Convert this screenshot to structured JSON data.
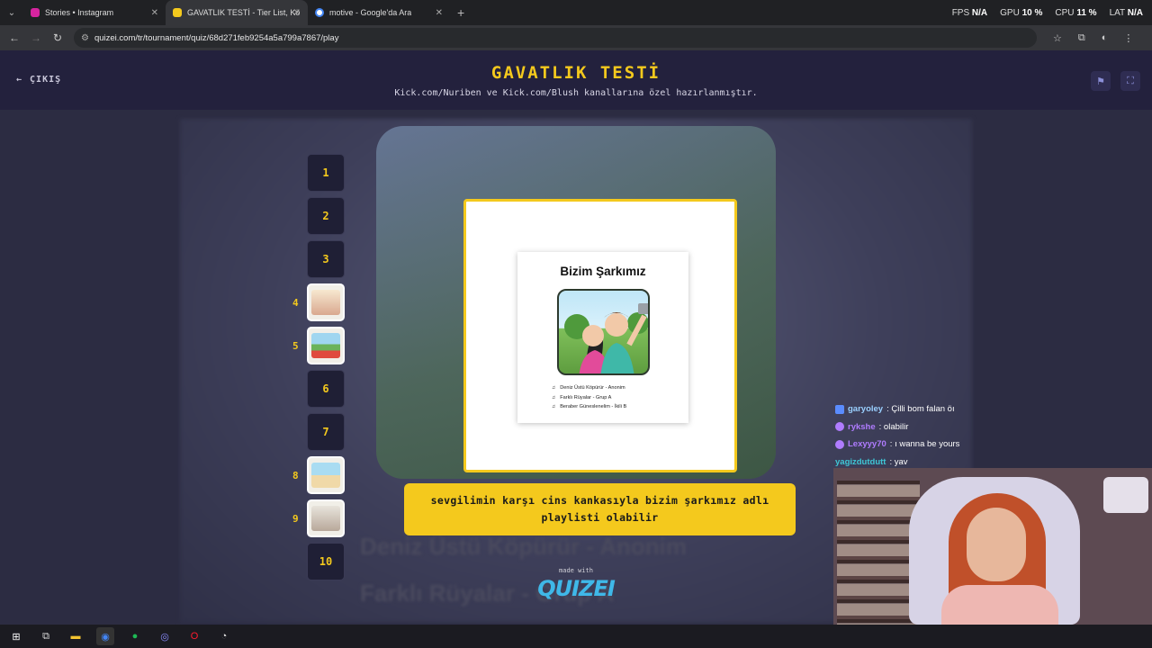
{
  "browser": {
    "tabs": [
      {
        "title": "Stories • Instagram",
        "fav_color": "#d6249f",
        "active": false
      },
      {
        "title": "GAVATLIK TESTİ - Tier List, Kör",
        "fav_color": "#f4c91d",
        "active": true
      },
      {
        "title": "motive - Google'da Ara",
        "fav_color": "#4285f4",
        "active": false
      }
    ],
    "url": "quizei.com/tr/tournament/quiz/68d271feb9254a5a799a7867/play",
    "perf": [
      {
        "label": "FPS",
        "value": "N/A"
      },
      {
        "label": "GPU",
        "value": "10 %"
      },
      {
        "label": "CPU",
        "value": "11 %"
      },
      {
        "label": "LAT",
        "value": "N/A"
      }
    ]
  },
  "header": {
    "exit_label": "ÇIKIŞ",
    "title": "GAVATLIK TESTİ",
    "subtitle": "Kick.com/Nuriben ve Kick.com/Blush kanallarına özel hazırlanmıştır."
  },
  "rounds": [
    "1",
    "2",
    "3",
    "4",
    "5",
    "6",
    "7",
    "8",
    "9",
    "10"
  ],
  "card": {
    "poster_title": "Bizim Şarkımız",
    "songs": [
      "Deniz Üstü Köpürür - Anonim",
      "Farklı Rüyalar - Grup A",
      "Beraber Güneslenelim - İkili B"
    ]
  },
  "caption": "sevgilimin karşı cins kankasıyla bizim şarkımız adlı playlisti olabilir",
  "footer": {
    "made_with": "made with",
    "logo": "QUIZEI"
  },
  "background_text": [
    "Deniz Üstü Köpürür - Anonim",
    "Farklı Rüyalar - Grup A"
  ],
  "chat": [
    {
      "user": "garyoley",
      "msg": ": Çilli bom falan öı",
      "color": "#9ad0ff"
    },
    {
      "user": "rykshe",
      "msg": ": olabilir",
      "color": "#b07cff"
    },
    {
      "user": "Lexyyy70",
      "msg": ": ı wanna be yours",
      "color": "#b07cff"
    },
    {
      "user": "yagizdutdutt",
      "msg": ": yav",
      "color": "#3ec7d6"
    }
  ],
  "colors": {
    "accent": "#f4c91d",
    "header_bg": "#23213d"
  }
}
